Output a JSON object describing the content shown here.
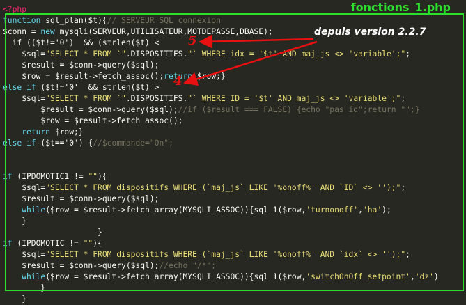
{
  "file_label": "fonctions_1.php",
  "annotation": "depuis version 2.2.7",
  "marker_5": "5",
  "marker_4": "4",
  "lines": [
    [
      [
        "tag",
        "<?php"
      ]
    ],
    [
      [
        "kw",
        "function "
      ],
      [
        "var",
        "sql_plan($t){"
      ],
      [
        "cmt",
        "// SERVEUR SQL connexion"
      ]
    ],
    [
      [
        "var",
        "$conn = "
      ],
      [
        "kw",
        "new "
      ],
      [
        "var",
        "mysqli(SERVEUR,UTILISATEUR,MOTDEPASSE,DBASE);"
      ]
    ],
    [
      [
        "var",
        "  if (("
      ],
      [
        "var",
        "$t!='0'"
      ],
      [
        "var",
        ")  && (strlen($t) < "
      ]
    ],
    [
      [
        "var",
        "    $sql="
      ],
      [
        "str",
        "\"SELECT * FROM `\""
      ],
      [
        "var",
        "."
      ],
      [
        "var",
        "DISPOSITIFS"
      ],
      [
        "var",
        "."
      ],
      [
        "str",
        "\"` WHERE idx = '$t' AND maj_js <> 'variable';\""
      ],
      [
        "var",
        ";"
      ]
    ],
    [
      [
        "var",
        "    $result = $conn->query($sql);"
      ]
    ],
    [
      [
        "var",
        "    $row = $result->fetch_assoc();"
      ],
      [
        "kw",
        "return "
      ],
      [
        "var",
        "$row;}"
      ]
    ],
    [
      [
        "kw",
        "else if "
      ],
      [
        "var",
        "($t!='0'  && strlen($t) > "
      ]
    ],
    [
      [
        "var",
        "    $sql="
      ],
      [
        "str",
        "\"SELECT * FROM `\""
      ],
      [
        "var",
        "."
      ],
      [
        "var",
        "DISPOSITIFS"
      ],
      [
        "var",
        "."
      ],
      [
        "str",
        "\"` WHERE ID = '$t' AND maj_js <> 'variable';\""
      ],
      [
        "var",
        ";"
      ]
    ],
    [
      [
        "var",
        "        $result = $conn->query($sql);"
      ],
      [
        "cmt",
        "//if ($result === FALSE) {echo \"pas id\";return \"\";}"
      ]
    ],
    [
      [
        "var",
        "        $row = $result->fetch_assoc();"
      ]
    ],
    [
      [
        "kw",
        "    return "
      ],
      [
        "var",
        "$row;}"
      ]
    ],
    [
      [
        "kw",
        "else if "
      ],
      [
        "var",
        "($t=='0') {"
      ],
      [
        "cmt",
        "//$commande=\"On\";"
      ]
    ],
    [
      [
        "var",
        ""
      ]
    ],
    [
      [
        "var",
        ""
      ]
    ],
    [
      [
        "kw",
        "if "
      ],
      [
        "var",
        "(IPDOMOTIC1 != "
      ],
      [
        "str",
        "\"\""
      ],
      [
        "var",
        "){"
      ]
    ],
    [
      [
        "var",
        "    $sql="
      ],
      [
        "str",
        "\"SELECT * FROM dispositifs WHERE (`maj_js` LIKE '%onoff%' AND `ID` <> '');\""
      ],
      [
        "var",
        ";"
      ]
    ],
    [
      [
        "var",
        "    $result = $conn->query($sql);"
      ]
    ],
    [
      [
        "kw",
        "    while"
      ],
      [
        "var",
        "($row = $result->fetch_array(MYSQLI_ASSOC)){sql_1($row,"
      ],
      [
        "str",
        "'turnonoff'"
      ],
      [
        "var",
        ","
      ],
      [
        "str",
        "'ha'"
      ],
      [
        "var",
        ");"
      ]
    ],
    [
      [
        "var",
        "    }"
      ]
    ],
    [
      [
        "var",
        "                    }"
      ]
    ],
    [
      [
        "kw",
        "if "
      ],
      [
        "var",
        "(IPDOMOTIC != "
      ],
      [
        "str",
        "\"\""
      ],
      [
        "var",
        "){"
      ]
    ],
    [
      [
        "var",
        "    $sql="
      ],
      [
        "str",
        "\"SELECT * FROM dispositifs WHERE (`maj_js` LIKE '%onoff%' AND `idx` <> '');\""
      ],
      [
        "var",
        ";"
      ]
    ],
    [
      [
        "var",
        "    $result = $conn->query($sql);"
      ],
      [
        "cmt",
        "//echo \"/*\";"
      ]
    ],
    [
      [
        "kw",
        "    while"
      ],
      [
        "var",
        "($row = $result->fetch_array(MYSQLI_ASSOC)){sql_1($row,"
      ],
      [
        "str",
        "'switchOnOff_setpoint'"
      ],
      [
        "var",
        ","
      ],
      [
        "str",
        "'dz'"
      ],
      [
        "var",
        ")"
      ]
    ],
    [
      [
        "var",
        "        }"
      ]
    ],
    [
      [
        "var",
        "    }"
      ]
    ]
  ]
}
